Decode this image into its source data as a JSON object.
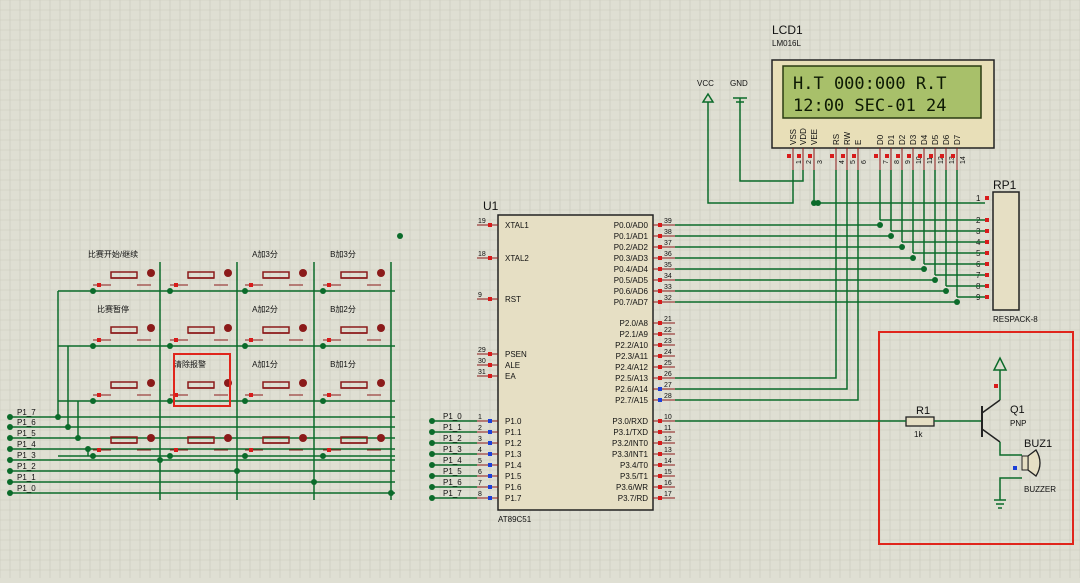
{
  "lcd": {
    "ref": "LCD1",
    "model": "LM016L",
    "line1": "H.T 000:000 R.T",
    "line2": "12:00 SEC-01  24",
    "pin_names": [
      "VSS",
      "VDD",
      "VEE",
      "RS",
      "RW",
      "E",
      "D0",
      "D1",
      "D2",
      "D3",
      "D4",
      "D5",
      "D6",
      "D7"
    ],
    "pin_numbers": [
      "1",
      "2",
      "3",
      "4",
      "5",
      "6",
      "7",
      "8",
      "9",
      "10",
      "11",
      "12",
      "13",
      "14"
    ]
  },
  "power": {
    "vcc": "VCC",
    "gnd": "GND"
  },
  "mcu": {
    "ref": "U1",
    "model": "AT89C51",
    "left_pins": [
      {
        "num": "19",
        "name": "XTAL1"
      },
      {
        "num": "18",
        "name": "XTAL2"
      },
      {
        "num": "9",
        "name": "RST"
      },
      {
        "num": "29",
        "name": "PSEN"
      },
      {
        "num": "30",
        "name": "ALE"
      },
      {
        "num": "31",
        "name": "EA"
      },
      {
        "num": "1",
        "name": "P1.0"
      },
      {
        "num": "2",
        "name": "P1.1"
      },
      {
        "num": "3",
        "name": "P1.2"
      },
      {
        "num": "4",
        "name": "P1.3"
      },
      {
        "num": "5",
        "name": "P1.4"
      },
      {
        "num": "6",
        "name": "P1.5"
      },
      {
        "num": "7",
        "name": "P1.6"
      },
      {
        "num": "8",
        "name": "P1.7"
      }
    ],
    "right_pins": [
      {
        "num": "39",
        "name": "P0.0/AD0"
      },
      {
        "num": "38",
        "name": "P0.1/AD1"
      },
      {
        "num": "37",
        "name": "P0.2/AD2"
      },
      {
        "num": "36",
        "name": "P0.3/AD3"
      },
      {
        "num": "35",
        "name": "P0.4/AD4"
      },
      {
        "num": "34",
        "name": "P0.5/AD5"
      },
      {
        "num": "33",
        "name": "P0.6/AD6"
      },
      {
        "num": "32",
        "name": "P0.7/AD7"
      },
      {
        "num": "21",
        "name": "P2.0/A8"
      },
      {
        "num": "22",
        "name": "P2.1/A9"
      },
      {
        "num": "23",
        "name": "P2.2/A10"
      },
      {
        "num": "24",
        "name": "P2.3/A11"
      },
      {
        "num": "25",
        "name": "P2.4/A12"
      },
      {
        "num": "26",
        "name": "P2.5/A13"
      },
      {
        "num": "27",
        "name": "P2.6/A14"
      },
      {
        "num": "28",
        "name": "P2.7/A15"
      },
      {
        "num": "10",
        "name": "P3.0/RXD"
      },
      {
        "num": "11",
        "name": "P3.1/TXD"
      },
      {
        "num": "12",
        "name": "P3.2/INT0"
      },
      {
        "num": "13",
        "name": "P3.3/INT1"
      },
      {
        "num": "14",
        "name": "P3.4/T0"
      },
      {
        "num": "15",
        "name": "P3.5/T1"
      },
      {
        "num": "16",
        "name": "P3.6/WR"
      },
      {
        "num": "17",
        "name": "P3.7/RD"
      }
    ]
  },
  "mcu_port_labels": [
    "P1_0",
    "P1_1",
    "P1_2",
    "P1_3",
    "P1_4",
    "P1_5",
    "P1_6",
    "P1_7"
  ],
  "keypad_row_labels": [
    "P1_7",
    "P1_6",
    "P1_5",
    "P1_4",
    "P1_3",
    "P1_2",
    "P1_1",
    "P1_0"
  ],
  "keypad_buttons": [
    "比赛开始/继续",
    "",
    "A加3分",
    "B加3分",
    "比赛暂停",
    "",
    "A加2分",
    "B加2分",
    "",
    "清除报警",
    "A加1分",
    "B加1分",
    "",
    "",
    "",
    ""
  ],
  "rp": {
    "ref": "RP1",
    "model": "RESPACK-8",
    "pins": [
      "1",
      "2",
      "3",
      "4",
      "5",
      "6",
      "7",
      "8",
      "9"
    ]
  },
  "buzzer_circuit": {
    "resistor_ref": "R1",
    "resistor_value": "1k",
    "transistor_ref": "Q1",
    "transistor_type": "PNP",
    "buzzer_ref": "BUZ1",
    "buzzer_model": "BUZZER"
  },
  "colors": {
    "background": "#dfdfd3",
    "grid": "#c9c9bc",
    "wire": "#0b6b2a",
    "component": "#8b1a1a",
    "lcd_screen": "#a8c06a",
    "lcd_body": "#e8dfb8",
    "highlight": "#e0251b",
    "pin_pos": "#d81b1b",
    "pin_neg": "#1b3fd8"
  }
}
